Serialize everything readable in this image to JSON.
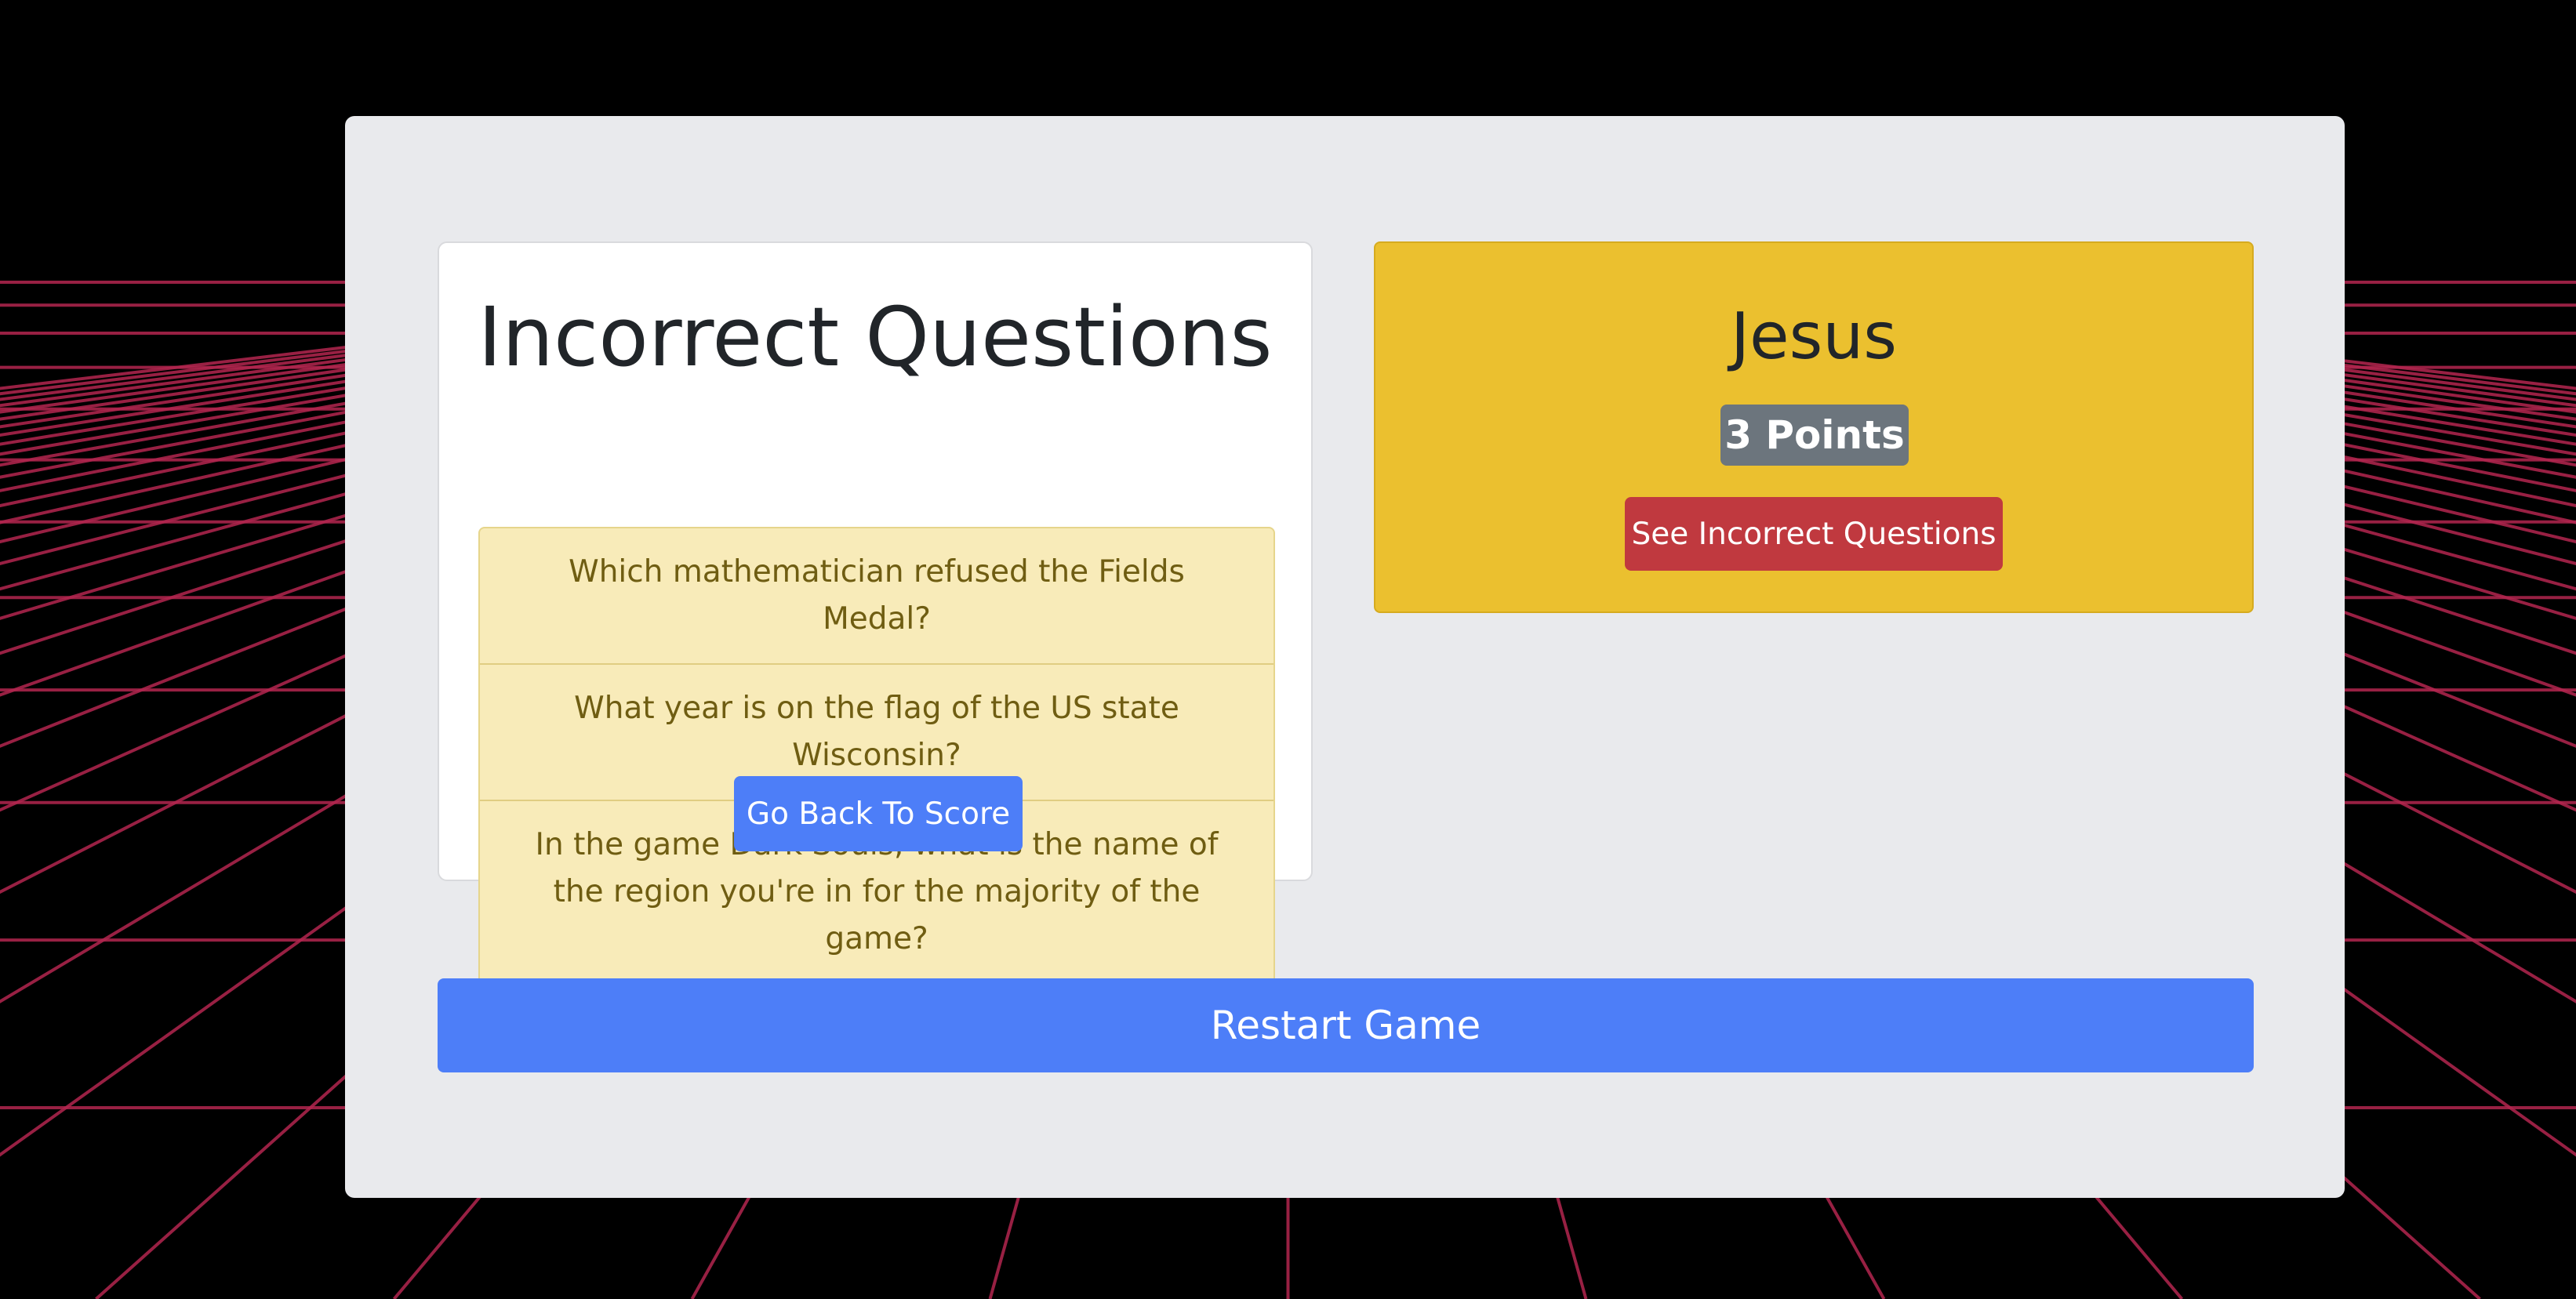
{
  "incorrect_card": {
    "title": "Incorrect Questions",
    "questions": [
      "Which mathematician refused the Fields Medal?",
      "What year is on the flag of the US state Wisconsin?",
      "In the game Dark Souls, what is the name of the region you're in for the majority of the game?"
    ],
    "back_button_label": "Go Back To Score"
  },
  "player_card": {
    "name": "Jesus",
    "points_label": "3 Points",
    "see_incorrect_label": "See Incorrect Questions"
  },
  "restart_label": "Restart Game",
  "colors": {
    "background": "#000000",
    "grid": "#b3264f",
    "panel": "#e9eaed",
    "player_card": "#ebc02f",
    "question_bg": "#f8ebb9",
    "primary_button": "#4d7ef8",
    "danger_button": "#c0393f",
    "badge": "#6c757d"
  }
}
